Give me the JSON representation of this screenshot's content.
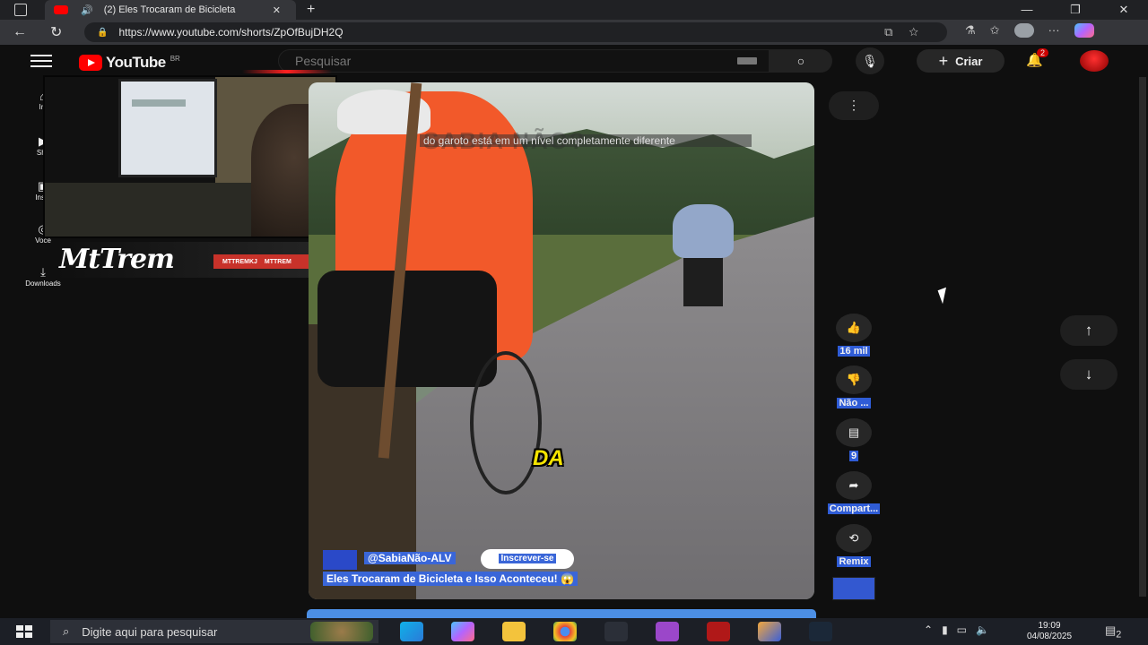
{
  "browser": {
    "tab_title": "(2) Eles Trocaram de Bicicleta",
    "tab_close": "✕",
    "new_tab": "+",
    "url": "https://www.youtube.com/shorts/ZpOfBujDH2Q"
  },
  "youtube": {
    "logo_text": "YouTube",
    "region": "BR",
    "search_placeholder": "Pesquisar",
    "create_label": "Criar",
    "notifications_count": "2"
  },
  "sidebar": {
    "items": [
      {
        "label": "Iní",
        "icon": "home-icon"
      },
      {
        "label": "Sho",
        "icon": "shorts-icon"
      },
      {
        "label": "Inscr",
        "icon": "subscriptions-icon"
      },
      {
        "label": "Você",
        "icon": "you-icon"
      },
      {
        "label": "Downloads",
        "icon": "download-icon"
      }
    ]
  },
  "overlay": {
    "streamer_name": "MtTrem",
    "socials": [
      "MTTREMKJ",
      "MTTREM"
    ]
  },
  "video": {
    "subtitle_top": "do garoto está em um nível completamente diferente",
    "watermark": "SABIA NÃO?",
    "caption_word": "DA",
    "channel": "@SabiaNão-ALV",
    "subscribe": "Inscrever-se",
    "title": "Eles Trocaram de Bicicleta e Isso Aconteceu! 😱"
  },
  "actions": {
    "likes": "16 mil",
    "dislike": "Não ...",
    "comments": "9",
    "share": "Compart...",
    "remix": "Remix"
  },
  "taskbar": {
    "search_placeholder": "Digite aqui para pesquisar",
    "time": "19:09",
    "date": "04/08/2025",
    "notif_count": "2"
  },
  "colors": {
    "youtube_red": "#ff0000",
    "highlight_blue": "#2f5cd6",
    "background": "#0f0f0f"
  }
}
